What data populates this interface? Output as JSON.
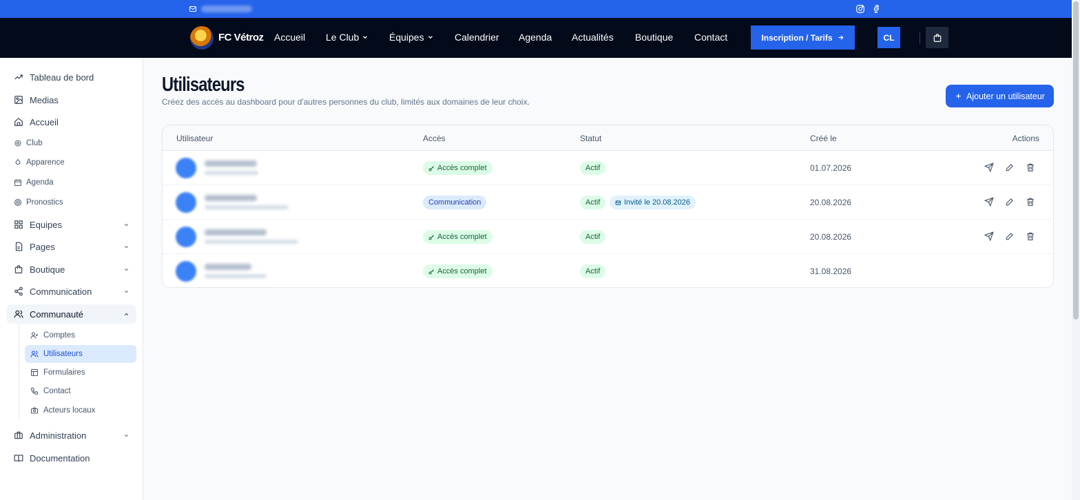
{
  "topbar": {
    "mail_icon": "mail-icon",
    "social": [
      "instagram-icon",
      "facebook-icon"
    ]
  },
  "navbar": {
    "brand": "FC Vétroz",
    "links": [
      "Accueil",
      "Le Club",
      "Équipes",
      "Calendrier",
      "Agenda",
      "Actualités",
      "Boutique",
      "Contact"
    ],
    "cta": "Inscription / Tarifs",
    "user_initials": "CL"
  },
  "sidebar": {
    "items": [
      "Tableau de bord",
      "Medias",
      "Accueil",
      "Club",
      "Apparence",
      "Agenda",
      "Pronostics",
      "Equipes",
      "Pages",
      "Boutique",
      "Communication",
      "Communauté",
      "Administration",
      "Documentation"
    ],
    "community_sub": [
      "Comptes",
      "Utilisateurs",
      "Formulaires",
      "Contact",
      "Acteurs locaux"
    ]
  },
  "main": {
    "title": "Utilisateurs",
    "subtitle": "Créez des accès au dashboard pour d'autres personnes du club, limités aux domaines de leur choix.",
    "add_button": "Ajouter un utilisateur"
  },
  "table": {
    "headers": [
      "Utilisateur",
      "Accès",
      "Statut",
      "Créé le",
      "Actions"
    ],
    "rows": [
      {
        "access": "Accès complet",
        "status": "Actif",
        "invite": "",
        "created": "01.07.2026"
      },
      {
        "access": "Communication",
        "status": "Actif",
        "invite": "Invité le 20.08.2026",
        "created": "20.08.2026"
      },
      {
        "access": "Accès complet",
        "status": "Actif",
        "invite": "",
        "created": "20.08.2026"
      },
      {
        "access": "Accès complet",
        "status": "Actif",
        "invite": "",
        "created": "31.08.2026"
      }
    ]
  },
  "colors": {
    "primary": "#2563eb",
    "navbar": "#030a1a",
    "success_bg": "#dcfce7",
    "success_text": "#166534"
  }
}
